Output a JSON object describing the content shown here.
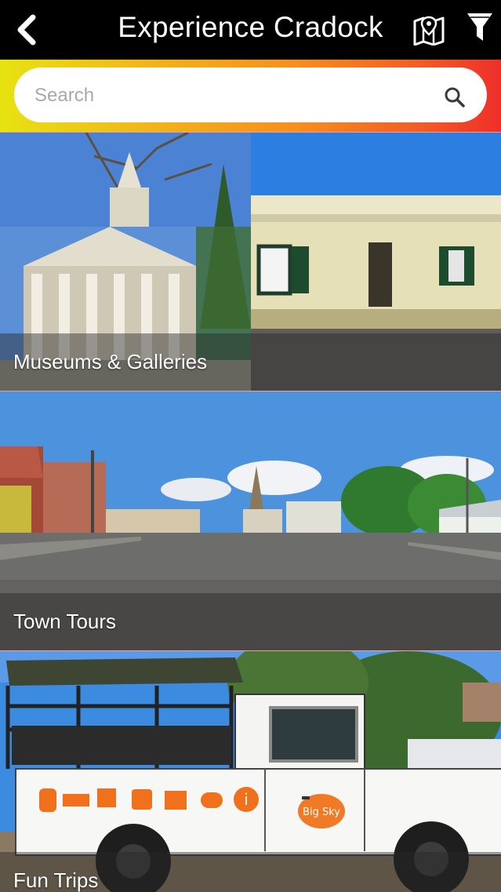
{
  "header": {
    "title": "Experience Cradock",
    "back_icon": "chevron-left-icon",
    "map_icon": "map-pin-icon",
    "filter_icon": "filter-icon"
  },
  "search": {
    "placeholder": "Search",
    "value": ""
  },
  "categories": [
    {
      "label": "Museums & Galleries"
    },
    {
      "label": "Town Tours"
    },
    {
      "label": "Fun Trips"
    }
  ],
  "colors": {
    "header_bg": "#000000",
    "gradient_start": "#e7e312",
    "gradient_end": "#ef2e2a",
    "vehicle_sign_orange": "#f0701c"
  },
  "vehicle": {
    "logo_text": "Big Sky"
  }
}
